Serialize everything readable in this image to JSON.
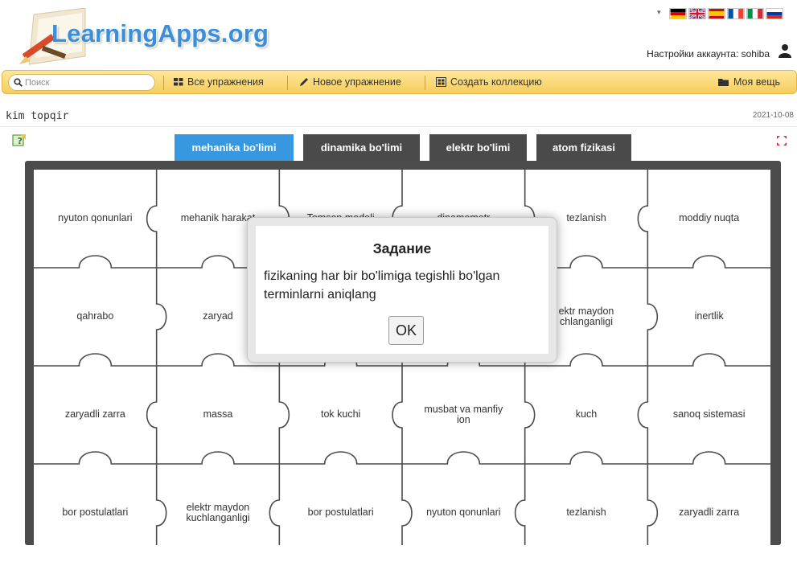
{
  "header": {
    "logo_text": "LearningApps.org",
    "language_dropdown_glyph": "▾",
    "flags": [
      "de",
      "en",
      "es",
      "fr",
      "it",
      "ru"
    ],
    "account_label": "Настройки аккаунта: sohiba",
    "account_icon": "user-icon"
  },
  "toolbar": {
    "search_placeholder": "Поиск",
    "all_exercises": "Все упражнения",
    "new_exercise": "Новое упражнение",
    "create_collection": "Создать коллекцию",
    "my_stuff": "Моя вещь"
  },
  "app": {
    "title": "kim topqir",
    "date": "2021-10-08"
  },
  "tabs": [
    {
      "label": "mehanika bo'limi",
      "active": true
    },
    {
      "label": "dinamika bo'limi",
      "active": false
    },
    {
      "label": "elektr bo'limi",
      "active": false
    },
    {
      "label": "atom fizikasi",
      "active": false
    }
  ],
  "pieces": [
    "nyuton qonunlari",
    "mehanik harakat",
    "Tomson modeli",
    "dinamometr",
    "tezlanish",
    "moddiy nuqta",
    "qahrabo",
    "zaryad",
    "",
    "",
    "ektr maydon\nchlanganligi",
    "inertlik",
    "zaryadli zarra",
    "massa",
    "tok kuchi",
    "musbat va manfiy ion",
    "kuch",
    "sanoq sistemasi",
    "bor postulatlari",
    "elektr maydon kuchlanganligi",
    "bor postulatlari",
    "nyuton qonunlari",
    "tezlanish",
    "zaryadli zarra"
  ],
  "dialog": {
    "title": "Задание",
    "text": "fizikaning har bir bo'limiga tegishli bo'lgan terminlarni aniqlang",
    "ok": "OK"
  },
  "colors": {
    "tab_active": "#3798e0",
    "tab_inactive": "#4a4a4a",
    "board": "#4b4b4b",
    "toolbar": "#f7cd5c",
    "logo": "#3a8fd8"
  }
}
